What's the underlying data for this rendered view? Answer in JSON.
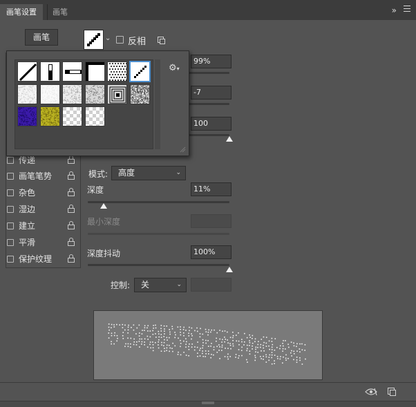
{
  "tabs": [
    {
      "label": "画笔设置",
      "active": true
    },
    {
      "label": "画笔",
      "active": false
    }
  ],
  "header": {
    "collapse_glyph": "»",
    "menu_icon": "hamburger-icon"
  },
  "brushes_button": {
    "label": "画笔"
  },
  "brush_tip": {
    "invert_label": "反相",
    "invert_checked": false
  },
  "options_list": [
    {
      "label": "传递",
      "checked": false
    },
    {
      "label": "画笔笔势",
      "checked": false
    },
    {
      "label": "杂色",
      "checked": false
    },
    {
      "label": "湿边",
      "checked": false
    },
    {
      "label": "建立",
      "checked": false
    },
    {
      "label": "平滑",
      "checked": false
    },
    {
      "label": "保护纹理",
      "checked": false
    }
  ],
  "texture": {
    "fields": {
      "scale": "99%",
      "brightness": "-7",
      "contrast": "100"
    },
    "mode_label": "模式:",
    "mode_value": "高度",
    "depth_label": "深度",
    "depth_value": "11%",
    "depth_level": 0.11,
    "min_depth_label": "最小深度",
    "min_depth_value": "",
    "depth_jitter_label": "深度抖动",
    "depth_jitter_value": "100%",
    "depth_jitter_level": 1.0,
    "control_label": "控制:",
    "control_value": "关",
    "control_field": ""
  },
  "picker": {
    "presets": [
      {
        "name": "diagonal-line-preset"
      },
      {
        "name": "vertical-bar-preset"
      },
      {
        "name": "horizontal-bar-preset"
      },
      {
        "name": "corner-block-preset"
      },
      {
        "name": "dots-preset"
      },
      {
        "name": "diagonal-dots-preset",
        "selected": true
      },
      {
        "name": "soft-texture-preset"
      },
      {
        "name": "light-texture-preset"
      },
      {
        "name": "noise-texture-preset"
      },
      {
        "name": "grain-texture-preset"
      },
      {
        "name": "concentric-square-preset"
      },
      {
        "name": "rock-texture-preset"
      },
      {
        "name": "purple-texture-preset"
      },
      {
        "name": "yellow-texture-preset"
      },
      {
        "name": "checker-texture-preset"
      },
      {
        "name": "checker-large-preset"
      }
    ],
    "colors": {
      "selected_outline": "#4b8fd0",
      "purple": "#3a1aa8",
      "yellow": "#b8b020"
    }
  },
  "colors": {
    "panel_bg": "#535353",
    "tabbar_bg": "#3c3c3c",
    "field_bg": "#454545"
  }
}
